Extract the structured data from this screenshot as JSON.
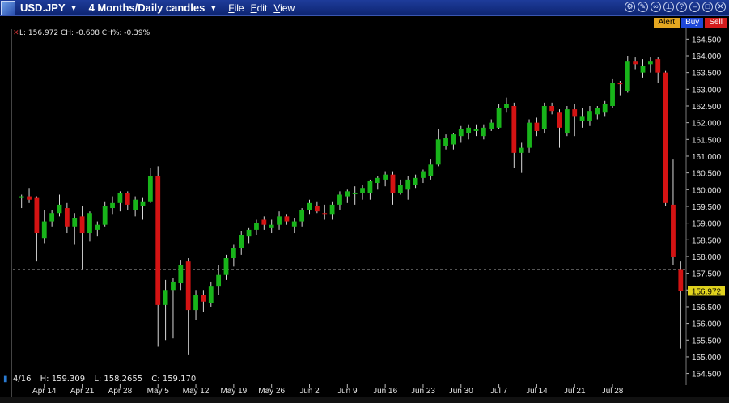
{
  "window": {
    "symbol": "USD.JPY",
    "period": "4 Months/Daily candles",
    "menus": [
      "File",
      "Edit",
      "View"
    ]
  },
  "toolbar": {
    "alert": "Alert",
    "buy": "Buy",
    "sell": "Sell"
  },
  "info_top": "L: 156.972 CH: -0.608 CH%: -0.39%",
  "info_bottom": {
    "date": "4/16",
    "h": "H: 159.309",
    "l": "L: 158.2655",
    "c": "C: 159.170"
  },
  "colors": {
    "up": "#18b41a",
    "down": "#d41313",
    "last_price_bg": "#e0d21e",
    "grid": "#333"
  },
  "chart_data": {
    "type": "candlestick",
    "y_ticks": [
      "154.500",
      "155.000",
      "155.500",
      "156.000",
      "156.500",
      "157.000",
      "157.500",
      "158.000",
      "158.500",
      "159.000",
      "159.500",
      "160.000",
      "160.500",
      "161.000",
      "161.500",
      "162.000",
      "162.500",
      "163.000",
      "163.500",
      "164.000",
      "164.500"
    ],
    "x_ticks": [
      "Apr 14",
      "Apr 21",
      "Apr 28",
      "May 5",
      "May 12",
      "May 19",
      "May 26",
      "Jun 2",
      "Jun 9",
      "Jun 16",
      "Jun 23",
      "Jun 30",
      "Jul 7",
      "Jul 14",
      "Jul 21",
      "Jul 28"
    ],
    "ylim": [
      154.2,
      164.75
    ],
    "last_price": "156.972",
    "reference_line": 157.6,
    "candles": [
      {
        "o": 159.75,
        "h": 159.85,
        "l": 159.45,
        "c": 159.8
      },
      {
        "o": 159.8,
        "h": 160.05,
        "l": 159.6,
        "c": 159.7
      },
      {
        "o": 159.75,
        "h": 159.8,
        "l": 157.85,
        "c": 158.7
      },
      {
        "o": 158.55,
        "h": 159.4,
        "l": 158.4,
        "c": 159.05
      },
      {
        "o": 159.05,
        "h": 159.4,
        "l": 158.9,
        "c": 159.3
      },
      {
        "o": 159.3,
        "h": 159.85,
        "l": 159.2,
        "c": 159.55
      },
      {
        "o": 159.45,
        "h": 159.6,
        "l": 158.7,
        "c": 158.9
      },
      {
        "o": 158.9,
        "h": 159.3,
        "l": 158.35,
        "c": 159.15
      },
      {
        "o": 159.2,
        "h": 159.5,
        "l": 157.6,
        "c": 158.7
      },
      {
        "o": 158.7,
        "h": 159.35,
        "l": 158.45,
        "c": 159.3
      },
      {
        "o": 158.8,
        "h": 159.05,
        "l": 158.6,
        "c": 158.95
      },
      {
        "o": 158.95,
        "h": 159.65,
        "l": 158.9,
        "c": 159.5
      },
      {
        "o": 159.45,
        "h": 159.8,
        "l": 159.25,
        "c": 159.6
      },
      {
        "o": 159.6,
        "h": 159.95,
        "l": 159.35,
        "c": 159.9
      },
      {
        "o": 159.9,
        "h": 159.95,
        "l": 159.4,
        "c": 159.55
      },
      {
        "o": 159.4,
        "h": 159.8,
        "l": 159.2,
        "c": 159.7
      },
      {
        "o": 159.5,
        "h": 159.75,
        "l": 159.1,
        "c": 159.65
      },
      {
        "o": 159.65,
        "h": 160.65,
        "l": 159.6,
        "c": 160.4
      },
      {
        "o": 160.4,
        "h": 160.7,
        "l": 155.3,
        "c": 156.55
      },
      {
        "o": 156.55,
        "h": 157.3,
        "l": 155.5,
        "c": 157.0
      },
      {
        "o": 157.0,
        "h": 157.35,
        "l": 155.55,
        "c": 157.25
      },
      {
        "o": 157.2,
        "h": 157.9,
        "l": 157.0,
        "c": 157.75
      },
      {
        "o": 157.85,
        "h": 157.95,
        "l": 155.05,
        "c": 156.4
      },
      {
        "o": 156.4,
        "h": 157.0,
        "l": 156.1,
        "c": 156.85
      },
      {
        "o": 156.85,
        "h": 157.0,
        "l": 156.35,
        "c": 156.65
      },
      {
        "o": 156.6,
        "h": 157.25,
        "l": 156.5,
        "c": 157.1
      },
      {
        "o": 157.1,
        "h": 157.75,
        "l": 156.85,
        "c": 157.45
      },
      {
        "o": 157.45,
        "h": 158.05,
        "l": 157.3,
        "c": 157.95
      },
      {
        "o": 157.95,
        "h": 158.35,
        "l": 157.7,
        "c": 158.25
      },
      {
        "o": 158.25,
        "h": 158.75,
        "l": 158.05,
        "c": 158.65
      },
      {
        "o": 158.6,
        "h": 158.85,
        "l": 158.4,
        "c": 158.8
      },
      {
        "o": 158.8,
        "h": 159.1,
        "l": 158.65,
        "c": 159.0
      },
      {
        "o": 159.1,
        "h": 159.2,
        "l": 158.8,
        "c": 158.95
      },
      {
        "o": 158.85,
        "h": 159.1,
        "l": 158.7,
        "c": 158.95
      },
      {
        "o": 158.95,
        "h": 159.35,
        "l": 158.8,
        "c": 159.2
      },
      {
        "o": 159.2,
        "h": 159.25,
        "l": 158.95,
        "c": 159.05
      },
      {
        "o": 158.9,
        "h": 159.15,
        "l": 158.7,
        "c": 159.05
      },
      {
        "o": 159.05,
        "h": 159.45,
        "l": 158.9,
        "c": 159.4
      },
      {
        "o": 159.4,
        "h": 159.7,
        "l": 159.25,
        "c": 159.6
      },
      {
        "o": 159.5,
        "h": 159.65,
        "l": 159.3,
        "c": 159.35
      },
      {
        "o": 159.3,
        "h": 159.55,
        "l": 159.1,
        "c": 159.25
      },
      {
        "o": 159.25,
        "h": 159.65,
        "l": 159.1,
        "c": 159.55
      },
      {
        "o": 159.55,
        "h": 159.95,
        "l": 159.4,
        "c": 159.85
      },
      {
        "o": 159.8,
        "h": 160.0,
        "l": 159.6,
        "c": 159.95
      },
      {
        "o": 159.9,
        "h": 160.1,
        "l": 159.55,
        "c": 159.9
      },
      {
        "o": 159.9,
        "h": 160.15,
        "l": 159.7,
        "c": 160.05
      },
      {
        "o": 159.9,
        "h": 160.3,
        "l": 159.7,
        "c": 160.25
      },
      {
        "o": 160.2,
        "h": 160.4,
        "l": 160.0,
        "c": 160.35
      },
      {
        "o": 160.3,
        "h": 160.55,
        "l": 160.1,
        "c": 160.45
      },
      {
        "o": 160.45,
        "h": 160.55,
        "l": 159.55,
        "c": 159.9
      },
      {
        "o": 159.9,
        "h": 160.3,
        "l": 159.85,
        "c": 160.15
      },
      {
        "o": 160.0,
        "h": 160.4,
        "l": 159.7,
        "c": 160.3
      },
      {
        "o": 160.15,
        "h": 160.45,
        "l": 160.05,
        "c": 160.35
      },
      {
        "o": 160.35,
        "h": 160.6,
        "l": 160.2,
        "c": 160.55
      },
      {
        "o": 160.4,
        "h": 160.9,
        "l": 160.3,
        "c": 160.75
      },
      {
        "o": 160.75,
        "h": 161.8,
        "l": 160.7,
        "c": 161.5
      },
      {
        "o": 161.3,
        "h": 161.65,
        "l": 161.2,
        "c": 161.55
      },
      {
        "o": 161.35,
        "h": 161.7,
        "l": 161.2,
        "c": 161.65
      },
      {
        "o": 161.6,
        "h": 161.9,
        "l": 161.4,
        "c": 161.8
      },
      {
        "o": 161.7,
        "h": 161.95,
        "l": 161.5,
        "c": 161.85
      },
      {
        "o": 161.75,
        "h": 161.95,
        "l": 161.6,
        "c": 161.8
      },
      {
        "o": 161.6,
        "h": 161.95,
        "l": 161.5,
        "c": 161.85
      },
      {
        "o": 161.8,
        "h": 162.1,
        "l": 161.75,
        "c": 162.0
      },
      {
        "o": 161.85,
        "h": 162.55,
        "l": 161.8,
        "c": 162.45
      },
      {
        "o": 162.45,
        "h": 162.75,
        "l": 162.3,
        "c": 162.55
      },
      {
        "o": 162.5,
        "h": 162.6,
        "l": 160.65,
        "c": 161.1
      },
      {
        "o": 161.1,
        "h": 161.4,
        "l": 160.5,
        "c": 161.25
      },
      {
        "o": 161.25,
        "h": 162.1,
        "l": 161.1,
        "c": 162.0
      },
      {
        "o": 162.0,
        "h": 162.15,
        "l": 161.6,
        "c": 161.75
      },
      {
        "o": 161.8,
        "h": 162.6,
        "l": 161.7,
        "c": 162.5
      },
      {
        "o": 162.5,
        "h": 162.6,
        "l": 162.25,
        "c": 162.35
      },
      {
        "o": 162.3,
        "h": 162.4,
        "l": 161.25,
        "c": 161.85
      },
      {
        "o": 161.7,
        "h": 162.5,
        "l": 161.6,
        "c": 162.4
      },
      {
        "o": 162.4,
        "h": 162.55,
        "l": 161.6,
        "c": 162.2
      },
      {
        "o": 162.05,
        "h": 162.45,
        "l": 161.85,
        "c": 162.2
      },
      {
        "o": 162.05,
        "h": 162.5,
        "l": 161.9,
        "c": 162.35
      },
      {
        "o": 162.25,
        "h": 162.5,
        "l": 162.1,
        "c": 162.45
      },
      {
        "o": 162.3,
        "h": 162.65,
        "l": 162.2,
        "c": 162.55
      },
      {
        "o": 162.5,
        "h": 163.3,
        "l": 162.45,
        "c": 163.2
      },
      {
        "o": 163.2,
        "h": 163.25,
        "l": 162.8,
        "c": 163.15
      },
      {
        "o": 162.95,
        "h": 164.0,
        "l": 162.9,
        "c": 163.85
      },
      {
        "o": 163.85,
        "h": 163.95,
        "l": 163.6,
        "c": 163.75
      },
      {
        "o": 163.5,
        "h": 163.9,
        "l": 163.35,
        "c": 163.7
      },
      {
        "o": 163.75,
        "h": 163.95,
        "l": 163.5,
        "c": 163.85
      },
      {
        "o": 163.9,
        "h": 163.95,
        "l": 163.2,
        "c": 163.5
      },
      {
        "o": 163.5,
        "h": 163.55,
        "l": 159.5,
        "c": 159.6
      },
      {
        "o": 159.55,
        "h": 160.9,
        "l": 157.75,
        "c": 158.0
      },
      {
        "o": 157.6,
        "h": 157.85,
        "l": 155.25,
        "c": 156.972
      }
    ]
  }
}
